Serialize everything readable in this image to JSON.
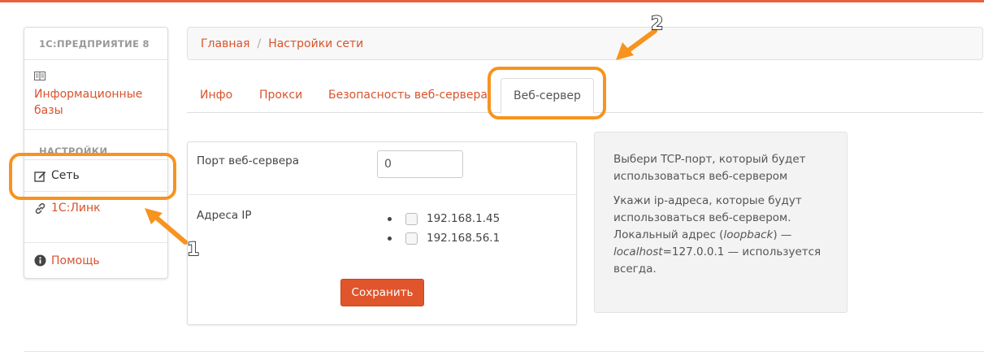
{
  "sidebar": {
    "header": "1С:ПРЕДПРИЯТИЕ 8",
    "infobases_label": "Информационные базы",
    "section_label": "НАСТРОЙКИ",
    "network_label": "Сеть",
    "link_label": "1С:Линк",
    "help_label": "Помощь"
  },
  "breadcrumb": {
    "home": "Главная",
    "separator": "/",
    "current": "Настройки сети"
  },
  "tabs": [
    {
      "label": "Инфо"
    },
    {
      "label": "Прокси"
    },
    {
      "label": "Безопасность веб-сервера"
    },
    {
      "label": "Веб-сервер",
      "active": true
    }
  ],
  "form": {
    "port_label": "Порт веб-сервера",
    "port_value": "0",
    "ip_label": "Адреса IP",
    "ip_addresses": [
      "192.168.1.45",
      "192.168.56.1"
    ],
    "save_label": "Сохранить"
  },
  "help": {
    "text1": "Выбери TCP-порт, который будет использоваться веб-сервером",
    "text2_part1": "Укажи ip-адреса, которые будут использоваться веб-сервером. Локальный адрес (",
    "text2_em1": "loopback",
    "text2_part2": ") — ",
    "text2_em2": "localhost",
    "text2_part3": "=127.0.0.1 — используется всегда."
  },
  "annotations": {
    "marker1": "1",
    "marker2": "2",
    "highlight_color": "#f7931e"
  },
  "colors": {
    "accent": "#d9532c",
    "button": "#e0552b"
  }
}
